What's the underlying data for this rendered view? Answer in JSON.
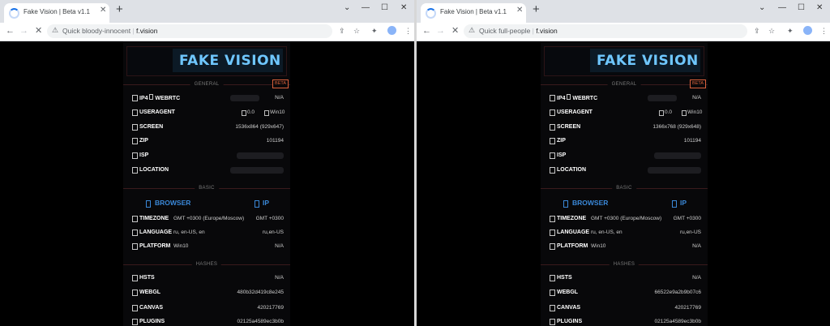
{
  "windows": [
    {
      "tab_title": "Fake Vision | Beta v1.1",
      "omnibox_label": "Quick bloody-innocent",
      "url": "f.vision",
      "site": {
        "logo": "FAKE VISION",
        "beta_badge": "BETA",
        "sections": {
          "general": "GENERAL",
          "basic": "BASIC",
          "hashes": "HASHES"
        },
        "general": {
          "ip4_label": "IP4",
          "webrtc_label": "WEBRTC",
          "webrtc_value": "N/A",
          "useragent_label": "USERAGENT",
          "ua_version": "0.0",
          "ua_os": "Win10",
          "screen_label": "SCREEN",
          "screen_value": "1536x864 (929x647)",
          "zip_label": "ZIP",
          "zip_value": "101194",
          "isp_label": "ISP",
          "location_label": "LOCATION"
        },
        "basic": {
          "browser_head": "BROWSER",
          "ip_head": "IP",
          "timezone_label": "TIMEZONE",
          "timezone_browser": "GMT +0300 (Europe/Moscow)",
          "timezone_ip": "GMT +0300",
          "language_label": "LANGUAGE",
          "language_browser": "ru, en-US, en",
          "language_ip": "ru,en-US",
          "platform_label": "PLATFORM",
          "platform_browser": "Win10",
          "platform_ip": "N/A"
        },
        "hashes": {
          "hsts_label": "HSTS",
          "hsts_value": "N/A",
          "webgl_label": "WEBGL",
          "webgl_value": "480b32d419c8e245",
          "canvas_label": "CANVAS",
          "canvas_value": "420217769",
          "plugins_label": "PLUGINS",
          "plugins_value": "02125a4589ec3b0b"
        }
      }
    },
    {
      "tab_title": "Fake Vision | Beta v1.1",
      "omnibox_label": "Quick full-people",
      "url": "f.vision",
      "site": {
        "logo": "FAKE VISION",
        "beta_badge": "BETA",
        "sections": {
          "general": "GENERAL",
          "basic": "BASIC",
          "hashes": "HASHES"
        },
        "general": {
          "ip4_label": "IP4",
          "webrtc_label": "WEBRTC",
          "webrtc_value": "N/A",
          "useragent_label": "USERAGENT",
          "ua_version": "0.0",
          "ua_os": "Win10",
          "screen_label": "SCREEN",
          "screen_value": "1366x768 (929x648)",
          "zip_label": "ZIP",
          "zip_value": "101194",
          "isp_label": "ISP",
          "location_label": "LOCATION"
        },
        "basic": {
          "browser_head": "BROWSER",
          "ip_head": "IP",
          "timezone_label": "TIMEZONE",
          "timezone_browser": "GMT +0300 (Europe/Moscow)",
          "timezone_ip": "GMT +0300",
          "language_label": "LANGUAGE",
          "language_browser": "ru, en-US, en",
          "language_ip": "ru,en-US",
          "platform_label": "PLATFORM",
          "platform_browser": "Win10",
          "platform_ip": "N/A"
        },
        "hashes": {
          "hsts_label": "HSTS",
          "hsts_value": "N/A",
          "webgl_label": "WEBGL",
          "webgl_value": "66522e9a2b9b07c6",
          "canvas_label": "CANVAS",
          "canvas_value": "420217769",
          "plugins_label": "PLUGINS",
          "plugins_value": "02125a4589ec3b0b"
        }
      }
    }
  ],
  "icons": {
    "window_controls": [
      "minimize-icon",
      "maximize-icon",
      "close-icon"
    ],
    "toolbar": [
      "share-icon",
      "star-icon",
      "extensions-icon",
      "profile-icon",
      "menu-icon"
    ]
  },
  "colors": {
    "accent_blue": "#3a88d8",
    "logo_cyan": "#6fc7ff",
    "beta_orange": "#d9603b",
    "page_bg": "#000000"
  }
}
